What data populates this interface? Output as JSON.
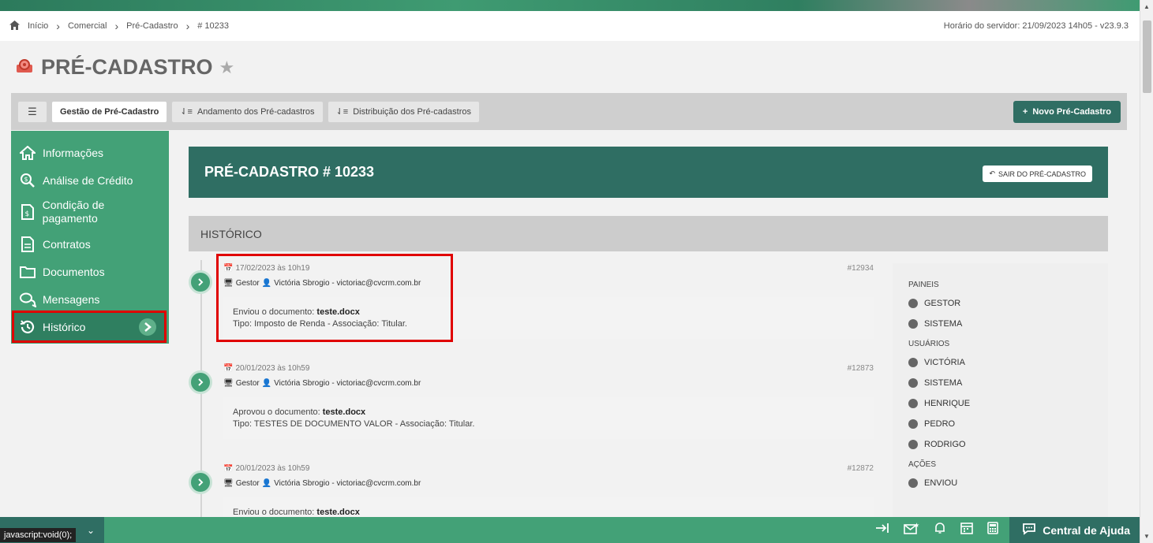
{
  "breadcrumb": {
    "items": [
      "Início",
      "Comercial",
      "Pré-Cadastro",
      "# 10233"
    ],
    "server_time": "Horário do servidor: 21/09/2023 14h05 - v23.9.3"
  },
  "page": {
    "title": "PRÉ-CADASTRO"
  },
  "tabs": {
    "items": [
      "Gestão de Pré-Cadastro",
      "Andamento dos Pré-cadastros",
      "Distribuição dos Pré-cadastros"
    ],
    "new_button": "Novo Pré-Cadastro"
  },
  "sidebar": {
    "items": [
      {
        "label": "Informações",
        "icon": "home-icon"
      },
      {
        "label": "Análise de Crédito",
        "icon": "search-dollar-icon"
      },
      {
        "label": "Condição de pagamento",
        "icon": "invoice-icon"
      },
      {
        "label": "Contratos",
        "icon": "document-icon"
      },
      {
        "label": "Documentos",
        "icon": "folder-icon"
      },
      {
        "label": "Mensagens",
        "icon": "chat-icon"
      },
      {
        "label": "Histórico",
        "icon": "history-icon"
      }
    ]
  },
  "header": {
    "title": "PRÉ-CADASTRO # 10233",
    "exit_button": "SAIR DO PRÉ-CADASTRO"
  },
  "history": {
    "title": "HISTÓRICO",
    "entries": [
      {
        "date": "17/02/2023 às 10h19",
        "panel": "Gestor",
        "user": "Victória Sbrogio - victoriac@cvcrm.com.br",
        "id": "#12934",
        "action": "Enviou o documento:",
        "file": "teste.docx",
        "detail": "Tipo: Imposto de Renda - Associação: Titular."
      },
      {
        "date": "20/01/2023 às 10h59",
        "panel": "Gestor",
        "user": "Victória Sbrogio - victoriac@cvcrm.com.br",
        "id": "#12873",
        "action": "Aprovou o documento:",
        "file": "teste.docx",
        "detail": "Tipo: TESTES DE DOCUMENTO VALOR - Associação: Titular."
      },
      {
        "date": "20/01/2023 às 10h59",
        "panel": "Gestor",
        "user": "Victória Sbrogio - victoriac@cvcrm.com.br",
        "id": "#12872",
        "action": "Enviou o documento:",
        "file": "teste.docx",
        "detail": ""
      }
    ]
  },
  "filters": {
    "paineis_title": "PAINEIS",
    "paineis": [
      "GESTOR",
      "SISTEMA"
    ],
    "usuarios_title": "USUÁRIOS",
    "usuarios": [
      "VICTÓRIA",
      "SISTEMA",
      "HENRIQUE",
      "PEDRO",
      "RODRIGO"
    ],
    "acoes_title": "AÇÕES",
    "acoes": [
      "ENVIOU"
    ]
  },
  "bottombar": {
    "help_label": "Central de Ajuda",
    "status_link": "javascript:void(0);"
  },
  "colors": {
    "primary_dark": "#2f6e63",
    "primary_green": "#43a177",
    "highlight_red": "#e00000"
  }
}
